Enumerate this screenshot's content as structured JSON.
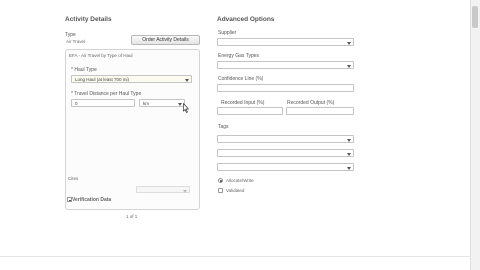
{
  "activity_details": {
    "heading": "Activity Details",
    "type_label": "Type",
    "type_value": "Air Travel",
    "order_button": "Order Activity Details",
    "panel": {
      "title": "EFA - Air Travel by Type of Haul",
      "haul_type_label": "* Haul Type",
      "haul_type_value": "Long Haul (at least 700 mi)",
      "distance_label": "* Travel Distance per Haul Type",
      "distance_value": "0",
      "unit_value": "km",
      "cites_label": "Cites",
      "verification_label": "Verification Data"
    },
    "pagination": "1 of 1"
  },
  "advanced_options": {
    "heading": "Advanced Options",
    "supplier_label": "Supplier",
    "energy_label": "Energy Gas Types",
    "confidence_label": "Confidence Line (%)",
    "recorded_input_label": "Recorded Input (%)",
    "recorded_output_label": "Recorded Output (%)",
    "tags_label": "Tags",
    "radio_label": "Allocate/Write",
    "checkbox_label": "Validated"
  }
}
